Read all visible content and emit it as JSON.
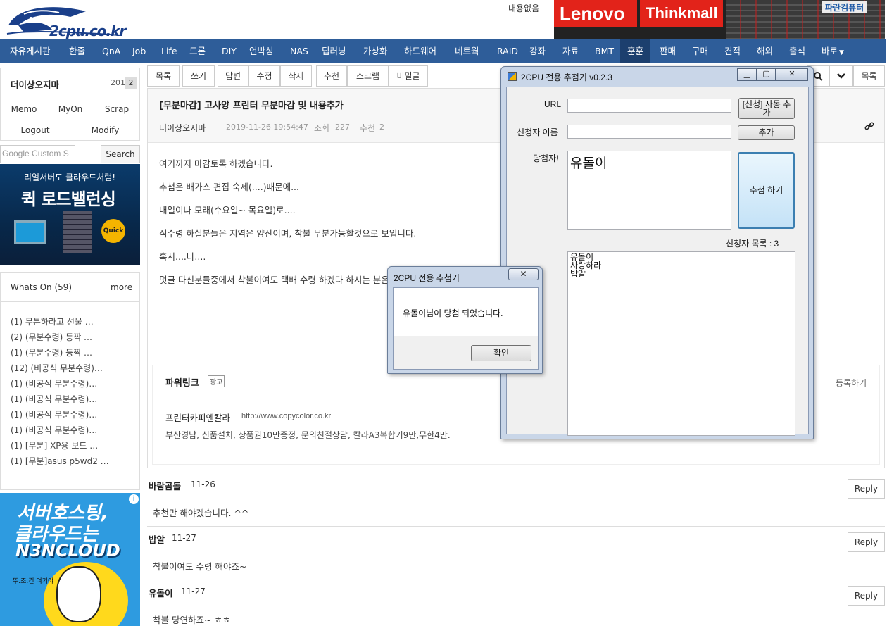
{
  "header": {
    "logo_text": "2cpu.co.kr",
    "no_content": "내용없음",
    "banner": {
      "lenovo": "Lenovo",
      "thinkmall": "Thinkmall",
      "paran": "파란컴퓨터"
    }
  },
  "nav": {
    "items": [
      "자유게시판",
      "한줄",
      "QnA",
      "Job",
      "Life",
      "드론",
      "DIY",
      "언박싱",
      "NAS",
      "딥러닝",
      "가상화",
      "하드웨어",
      "네트웍",
      "RAID",
      "강좌",
      "자료",
      "BMT",
      "훈훈",
      "판매",
      "구매",
      "견적",
      "해외",
      "출석",
      "바로"
    ],
    "active": "훈훈",
    "colors": {
      "bar": "#2e5d99",
      "active": "#1c3f6e"
    }
  },
  "sidebar": {
    "username": "더이상오지마",
    "user_number": "201",
    "user_badge": "2",
    "buttons": [
      "Memo",
      "MyOn",
      "Scrap",
      "Logout",
      "Modify"
    ],
    "search_placeholder": "Google Custom S",
    "search_button": "Search",
    "ad1": {
      "line1": "리얼서버도 클라우드처럼!",
      "line2": "퀵 로드밸런싱",
      "badge": "Quick"
    },
    "whats_on": {
      "title": "Whats On (59)",
      "more": "more",
      "items": [
        "(1) 무분하라고 선물 …",
        "(2) (무분수령) 등짝 …",
        "(1) (무분수령) 등짝 …",
        "(12) (비공식 무분수령)…",
        "(1) (비공식 무분수령)…",
        "(1) (비공식 무분수령)…",
        "(1) (비공식 무분수령)…",
        "(1) (비공식 무분수령)…",
        "(1) [무분] XP용 보드 …",
        "(1) [무분]asus p5wd2 …"
      ]
    },
    "ad2": {
      "line1": "서버호스팅,",
      "line2": "클라우드는",
      "line3": "N3NCLOUD",
      "side": "뚜.조.건 여기야"
    }
  },
  "toolbar": {
    "buttons": [
      "목록",
      "쓰기",
      "답변",
      "수정",
      "삭제",
      "추천",
      "스크랩",
      "비밀글"
    ],
    "right_list": "목록",
    "zoom_icon": "🔍",
    "down_icon": "⌄"
  },
  "post": {
    "title": "[무분마감] 고사양 프린터 무분마감 및 내용추가",
    "author": "더이상오지마",
    "date": "2019-11-26 19:54:47",
    "views_label": "조회",
    "views": "227",
    "rec_label": "추천",
    "rec": "2",
    "body": [
      "여기까지 마감토록 하겠습니다.",
      "추첨은 배가스 편집 숙제(....)때문에...",
      "내일이나 모래(수요일~ 목요일)로....",
      "직수령 하실분들은 지역은 양산이며, 착불 무분가능할것으로 보입니다.",
      "혹시....나....",
      "덧글 다신분들중에서 착불이여도 택배 수령 하겠다 하시는 분은"
    ],
    "powerlink": {
      "title": "파워링크",
      "ad_tag": "광고",
      "register": "등록하기",
      "name": "프린터카피엔칼라",
      "url": "http://www.copycolor.co.kr",
      "desc": "부산경남, 신품설치, 상품권10만증정, 문의친절상담, 칼라A3복합기9만,무한4만."
    }
  },
  "comments": [
    {
      "author": "바람곰돌",
      "date": "11-26",
      "text": "추천만 해야겠습니다. ^^",
      "reply": "Reply"
    },
    {
      "author": "밥알",
      "date": "11-27",
      "text": "착불이여도 수령 해야죠~",
      "reply": "Reply"
    },
    {
      "author": "유돌이",
      "date": "11-27",
      "text": "착불 당연하죠~ ㅎㅎ",
      "reply": "Reply"
    }
  ],
  "picker": {
    "title": "2CPU 전용 추첨기 v0.2.3",
    "url_label": "URL",
    "url_value": "",
    "auto_add_button": "[신청] 자동 추가",
    "applicant_label": "신청자 이름",
    "applicant_value": "",
    "add_button": "추가",
    "winner_label": "당첨자!",
    "winner_value": "유돌이",
    "draw_button": "추첨 하기",
    "count_label": "신청자 목록 : 3",
    "applicants": [
      "유돌이",
      "사랑하라",
      "밥알"
    ]
  },
  "msgbox": {
    "title": "2CPU 전용 추첨기",
    "text": "유돌이님이 당첨 되었습니다.",
    "ok": "확인",
    "close": "✕"
  }
}
